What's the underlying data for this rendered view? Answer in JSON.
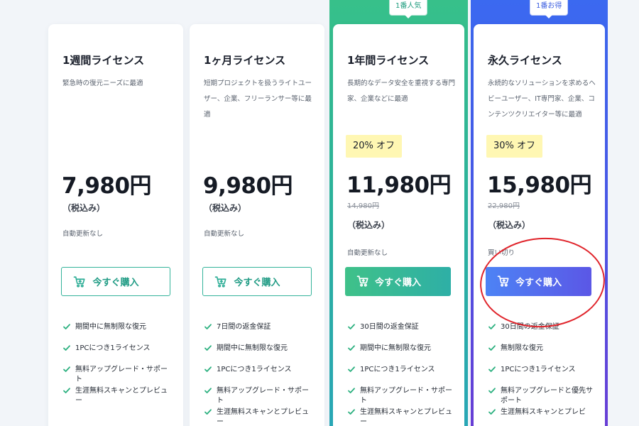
{
  "colors": {
    "teal_accent": "#2bb3a0",
    "blue_accent": "#4a58e8",
    "discount_bg": "#fff7b3",
    "annotation": "#e0242b"
  },
  "ribbons": {
    "popular": "1番人気",
    "best_value": "1番お得"
  },
  "plans": [
    {
      "title": "1週間ライセンス",
      "description": "緊急時の復元ニーズに最適",
      "price": "7,980円",
      "tax_note": "（税込み）",
      "renewal": "自動更新なし",
      "buy_label": "今すぐ購入",
      "buy_icon": "cart-icon",
      "features": [
        "期間中に無制限な復元",
        "1PCにつき1ライセンス",
        "無料アップグレード・サポート",
        "生涯無料スキャンとプレビュー"
      ]
    },
    {
      "title": "1ヶ月ライセンス",
      "description": "短期プロジェクトを扱うライトユーザー、企業、フリーランサー等に最適",
      "price": "9,980円",
      "tax_note": "（税込み）",
      "renewal": "自動更新なし",
      "buy_label": "今すぐ購入",
      "buy_icon": "cart-icon",
      "features": [
        "7日間の返金保証",
        "期間中に無制限な復元",
        "1PCにつき1ライセンス",
        "無料アップグレード・サポート",
        "生涯無料スキャンとプレビュー"
      ]
    },
    {
      "title": "1年間ライセンス",
      "description": "長期的なデータ安全を重視する専門家、企業などに最適",
      "discount": "20% オフ",
      "price": "11,980円",
      "original_price": "14,980円",
      "tax_note": "（税込み）",
      "renewal": "自動更新なし",
      "buy_label": "今すぐ購入",
      "buy_icon": "cart-icon",
      "features": [
        "30日間の返金保証",
        "期間中に無制限な復元",
        "1PCにつき1ライセンス",
        "無料アップグレード・サポート",
        "生涯無料スキャンとプレビュー"
      ]
    },
    {
      "title": "永久ライセンス",
      "description": "永続的なソリューションを求めるヘビーユーザー、IT専門家、企業、コンテンツクリエイター等に最適",
      "discount": "30% オフ",
      "price": "15,980円",
      "original_price": "22,980円",
      "tax_note": "（税込み）",
      "renewal": "買い切り",
      "buy_label": "今すぐ購入",
      "buy_icon": "cart-icon",
      "features": [
        "30日間の返金保証",
        "無制限な復元",
        "1PCにつき1ライセンス",
        "無料アップグレードと優先サポート",
        "生涯無料スキャンとプレビ"
      ]
    }
  ]
}
